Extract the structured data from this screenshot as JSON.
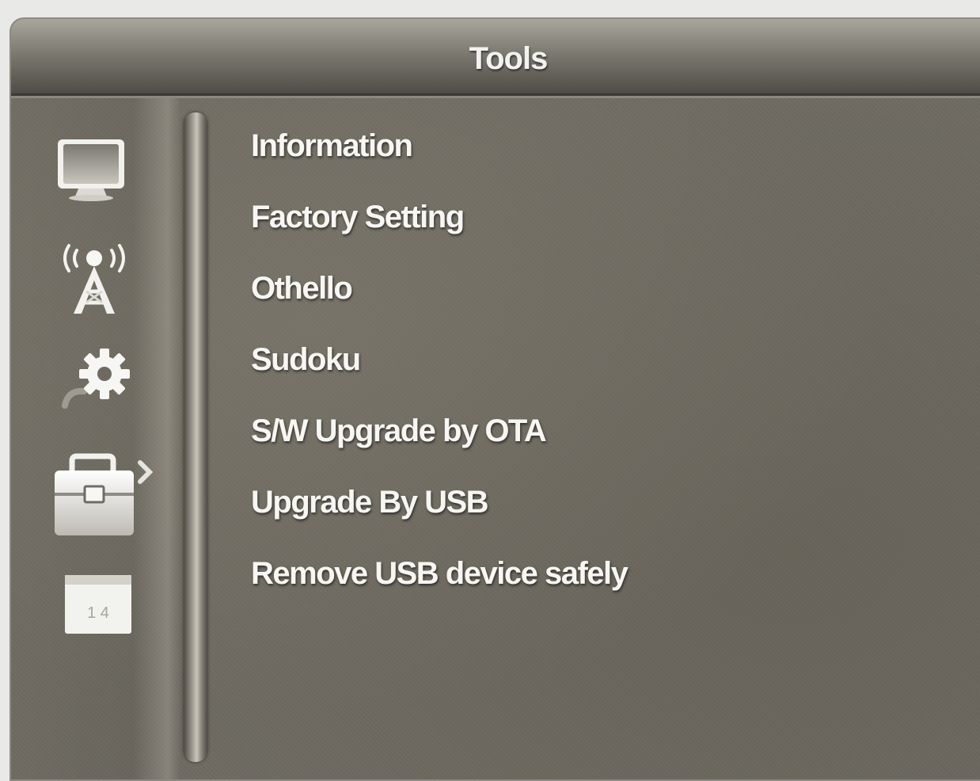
{
  "header": {
    "title": "Tools"
  },
  "sidebar": {
    "icons": [
      {
        "name": "tv-icon",
        "selected": false
      },
      {
        "name": "antenna-icon",
        "selected": false
      },
      {
        "name": "gear-icon",
        "selected": false
      },
      {
        "name": "toolbox-icon",
        "selected": true
      },
      {
        "name": "calendar-icon",
        "selected": false
      }
    ]
  },
  "menu": {
    "items": [
      {
        "label": "Information"
      },
      {
        "label": "Factory Setting"
      },
      {
        "label": "Othello"
      },
      {
        "label": "Sudoku"
      },
      {
        "label": "S/W Upgrade by OTA"
      },
      {
        "label": "Upgrade By USB"
      },
      {
        "label": "Remove USB device safely"
      }
    ]
  },
  "colors": {
    "background": "#6e6a61",
    "text": "#f6f6f3",
    "title_bar": "#7d7a72"
  }
}
